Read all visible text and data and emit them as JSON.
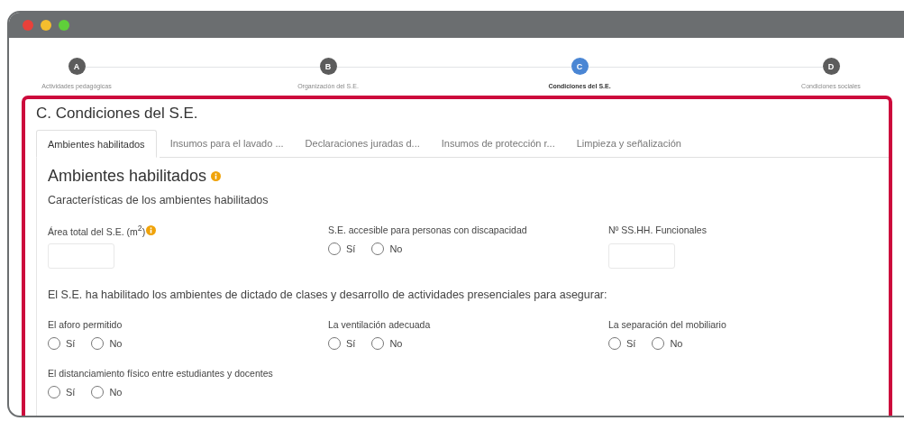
{
  "stepper": {
    "steps": [
      {
        "letter": "A",
        "label": "Actividades pedagógicas",
        "selected": false
      },
      {
        "letter": "B",
        "label": "Organización del S.E.",
        "selected": false
      },
      {
        "letter": "C",
        "label": "Condiciones del S.E.",
        "selected": true
      },
      {
        "letter": "D",
        "label": "Condiciones sociales",
        "selected": false
      }
    ]
  },
  "section": {
    "title": "C. Condiciones del S.E.",
    "tabs": [
      {
        "label": "Ambientes habilitados",
        "selected": true
      },
      {
        "label": "Insumos para el lavado ...",
        "selected": false
      },
      {
        "label": "Declaraciones juradas d...",
        "selected": false
      },
      {
        "label": "Insumos de protección r...",
        "selected": false
      },
      {
        "label": "Limpieza y señalización",
        "selected": false
      }
    ],
    "panel": {
      "heading": "Ambientes habilitados",
      "subtitle": "Características de los ambientes habilitados",
      "rows": [
        {
          "kind": "fields",
          "fields": [
            {
              "kind": "input",
              "label": "Área total del S.E. (m$^{2}$)",
              "info": true
            },
            {
              "kind": "radio",
              "label": "S.E. accesible para personas con discapacidad",
              "info": false,
              "options": [
                {
                  "label": "Sí",
                  "selected": false
                },
                {
                  "label": "No",
                  "selected": false
                }
              ]
            },
            {
              "kind": "input",
              "label": "Nº SS.HH. Funcionales",
              "info": false
            }
          ]
        },
        {
          "kind": "text",
          "text": "El S.E. ha habilitado los ambientes de dictado de clases y desarrollo de actividades presenciales para asegurar:"
        },
        {
          "kind": "fields",
          "fields": [
            {
              "kind": "radio",
              "label": "El aforo permitido",
              "info": false,
              "options": [
                {
                  "label": "Sí",
                  "selected": false
                },
                {
                  "label": "No",
                  "selected": false
                }
              ]
            },
            {
              "kind": "radio",
              "label": "La ventilación adecuada",
              "info": false,
              "options": [
                {
                  "label": "Sí",
                  "selected": false
                },
                {
                  "label": "No",
                  "selected": false
                }
              ]
            },
            {
              "kind": "radio",
              "label": "La separación del mobiliario",
              "info": false,
              "options": [
                {
                  "label": "Sí",
                  "selected": false
                },
                {
                  "label": "No",
                  "selected": false
                }
              ]
            }
          ]
        },
        {
          "kind": "fields",
          "fields": [
            {
              "kind": "radio",
              "label": "El distanciamiento físico entre estudiantes y docentes",
              "info": false,
              "options": [
                {
                  "label": "Sí",
                  "selected": false
                },
                {
                  "label": "No",
                  "selected": false
                }
              ]
            }
          ]
        }
      ]
    }
  }
}
